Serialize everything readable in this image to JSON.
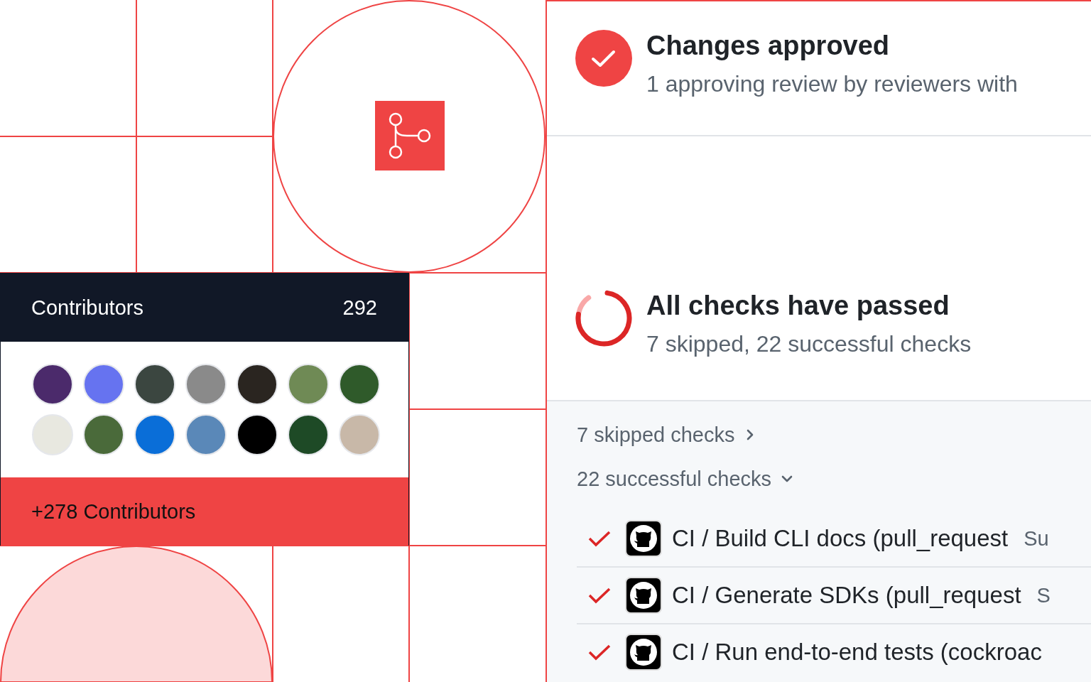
{
  "contributors": {
    "title": "Contributors",
    "count": "292",
    "avatars": [
      {
        "color": "#4b2a6b"
      },
      {
        "color": "#6673f0"
      },
      {
        "color": "#3b4640"
      },
      {
        "color": "#8a8a8a"
      },
      {
        "color": "#2a2520"
      },
      {
        "color": "#6f8a55"
      },
      {
        "color": "#2f5a2a"
      },
      {
        "color": "#e8e8e0"
      },
      {
        "color": "#4a6a3a"
      },
      {
        "color": "#0a6ed8"
      },
      {
        "color": "#5a88b8"
      },
      {
        "color": "#000000"
      },
      {
        "color": "#1e4a26"
      },
      {
        "color": "#c8b8a8"
      }
    ],
    "more": "+278 Contributors"
  },
  "review": {
    "title": "Changes approved",
    "subtitle": "1 approving review by reviewers with"
  },
  "checks": {
    "title": "All checks have passed",
    "subtitle": "7 skipped, 22 successful checks",
    "groups": [
      {
        "label": "7 skipped checks",
        "expanded": false
      },
      {
        "label": "22 successful checks",
        "expanded": true
      }
    ],
    "rows": [
      {
        "name": "CI / Build CLI docs (pull_request",
        "status": "Su"
      },
      {
        "name": "CI / Generate SDKs (pull_request",
        "status": "S"
      },
      {
        "name": "CI / Run end-to-end tests (cockroac",
        "status": ""
      }
    ]
  }
}
